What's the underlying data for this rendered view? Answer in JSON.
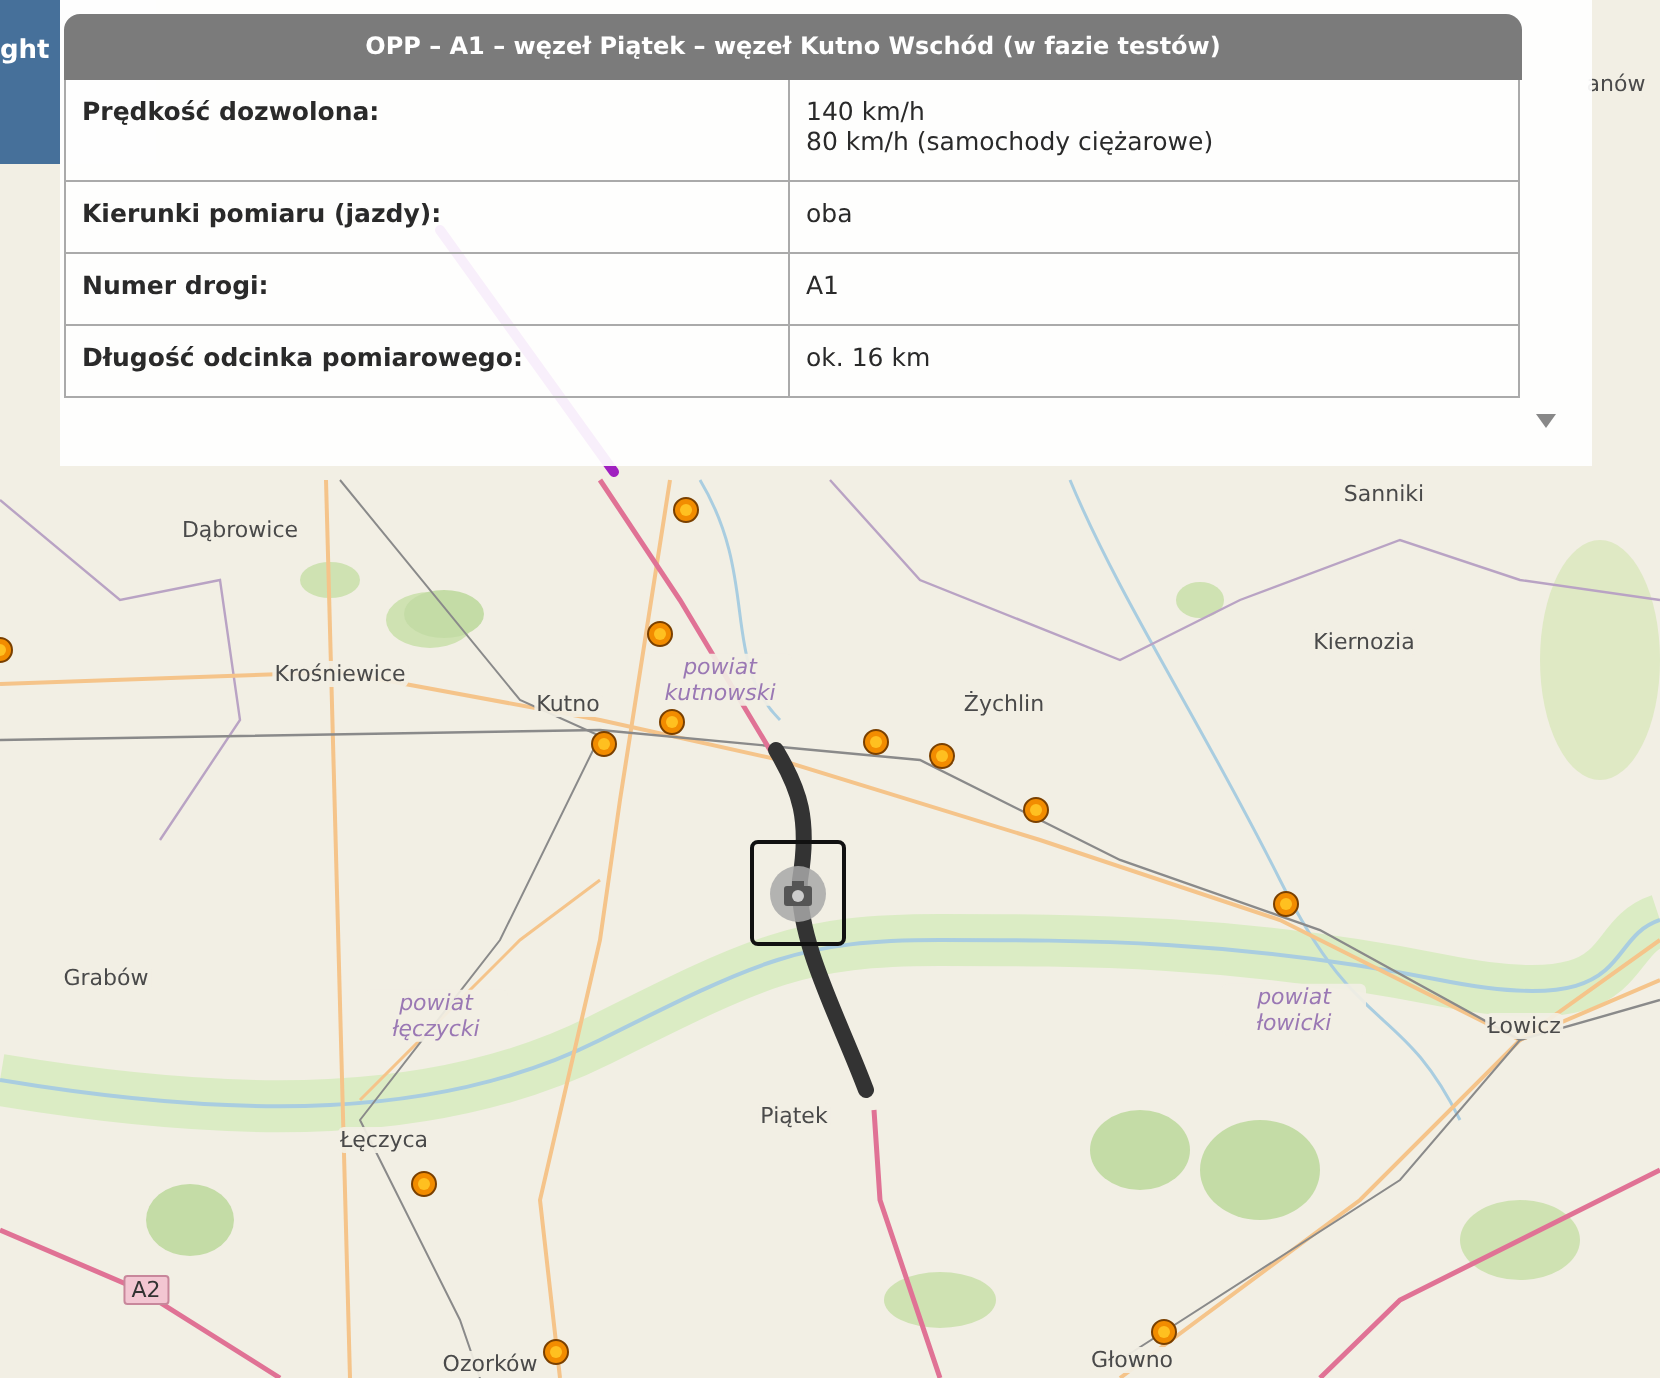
{
  "side_panel": {
    "label": "ght"
  },
  "popup": {
    "title": "OPP – A1 – węzeł Piątek – węzeł Kutno Wschód (w fazie testów)",
    "rows": [
      {
        "label": "Prędkość dozwolona:",
        "lines": [
          "140 km/h",
          "80 km/h (samochody ciężarowe)"
        ]
      },
      {
        "label": "Kierunki pomiaru (jazdy):",
        "lines": [
          "oba"
        ]
      },
      {
        "label": "Numer drogi:",
        "lines": [
          "A1"
        ]
      },
      {
        "label": "Długość odcinka pomiarowego:",
        "lines": [
          "ok. 16 km"
        ]
      }
    ]
  },
  "map": {
    "labels": [
      {
        "kind": "town",
        "text": "anów"
      },
      {
        "kind": "town",
        "text": "Dąbrowice"
      },
      {
        "kind": "town",
        "text": "Sanniki"
      },
      {
        "kind": "town",
        "text": "Kiernozia"
      },
      {
        "kind": "town",
        "text": "Krośniewice"
      },
      {
        "kind": "county",
        "text": "powiat kutnowski"
      },
      {
        "kind": "town",
        "text": "Kutno"
      },
      {
        "kind": "town",
        "text": "Żychlin"
      },
      {
        "kind": "town",
        "text": "Grabów"
      },
      {
        "kind": "county",
        "text": "powiat łęczycki"
      },
      {
        "kind": "county",
        "text": "powiat łowicki"
      },
      {
        "kind": "town",
        "text": "Łowicz"
      },
      {
        "kind": "town",
        "text": "Piątek"
      },
      {
        "kind": "town",
        "text": "Łęczyca"
      },
      {
        "kind": "road",
        "text": "A2"
      },
      {
        "kind": "town",
        "text": "Głowno"
      },
      {
        "kind": "town",
        "text": "Ozorków"
      }
    ]
  }
}
